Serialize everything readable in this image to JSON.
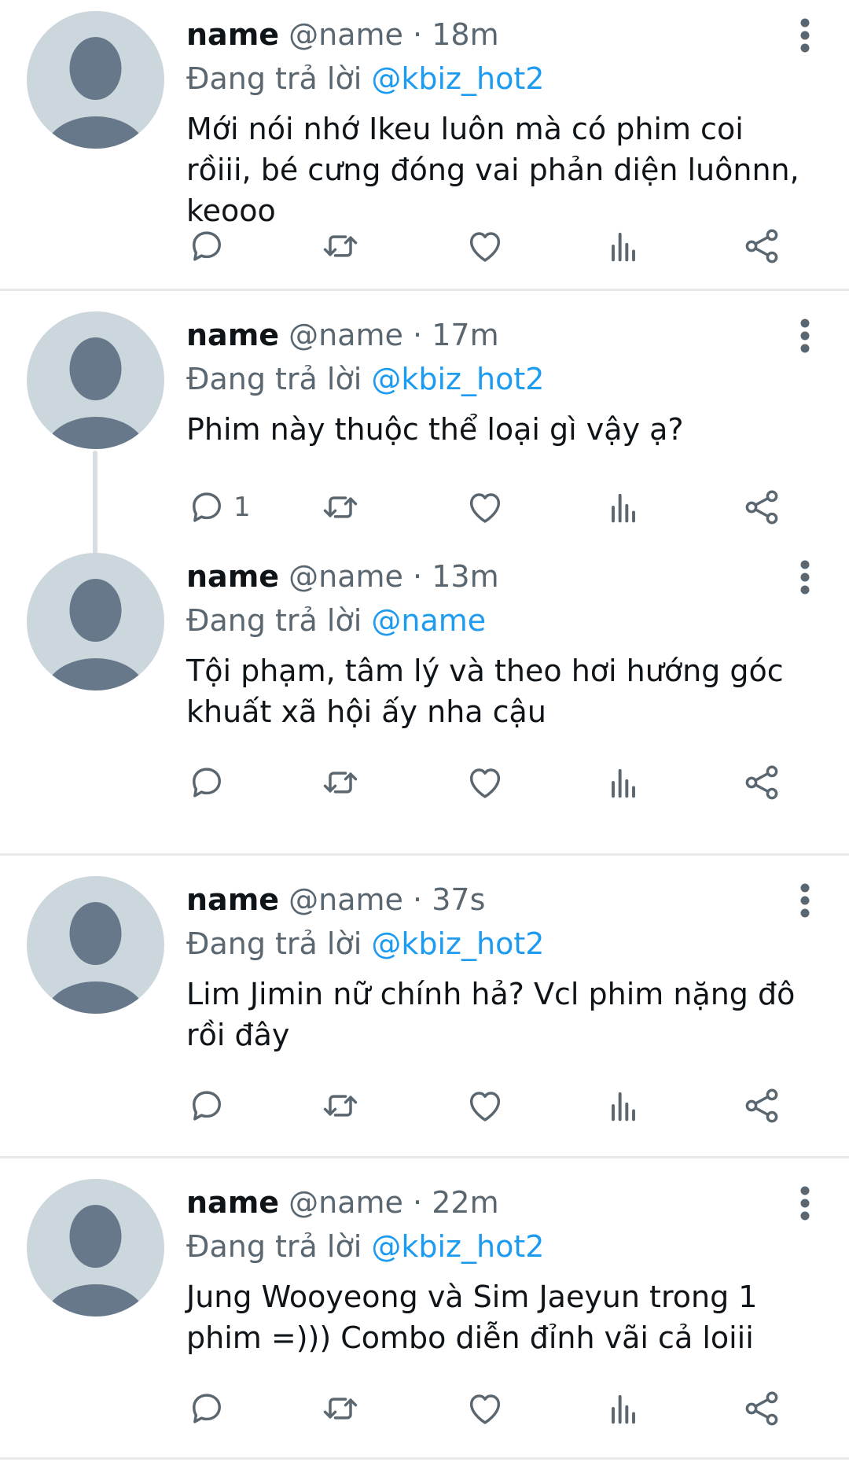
{
  "colors": {
    "text": "#0f1419",
    "secondary": "#5b6770",
    "link": "#1d9bf0",
    "avatar_bg": "#ccd6dd",
    "avatar_fg": "#66788a",
    "separator": "#e7e9eb",
    "thread_line": "#d8dde1"
  },
  "icons": {
    "more": "more-vertical-icon",
    "reply": "speech-bubble-icon",
    "retweet": "retweet-icon",
    "like": "heart-icon",
    "views": "bar-chart-icon",
    "share": "share-icon"
  },
  "reply_prefix": "Đang trả lời",
  "tweets": [
    {
      "display_name": "name",
      "handle": "@name",
      "separator": "·",
      "time": "18m",
      "reply_to": "@kbiz_hot2",
      "text": "Mới nói nhớ Ikeu luôn mà có phim coi rồiii, bé cưng đóng vai phản diện luônnn, keooo",
      "reply_count": ""
    },
    {
      "display_name": "name",
      "handle": "@name",
      "separator": "·",
      "time": "17m",
      "reply_to": "@kbiz_hot2",
      "text": "Phim này thuộc thể loại gì vậy ạ?",
      "reply_count": "1"
    },
    {
      "display_name": "name",
      "handle": "@name",
      "separator": "·",
      "time": "13m",
      "reply_to": "@name",
      "text": "Tội phạm, tâm lý và theo hơi hướng góc khuất xã hội ấy nha cậu",
      "reply_count": ""
    },
    {
      "display_name": "name",
      "handle": "@name",
      "separator": "·",
      "time": "37s",
      "reply_to": "@kbiz_hot2",
      "text": "Lim Jimin nữ chính hả? Vcl phim nặng đô rồi đây",
      "reply_count": ""
    },
    {
      "display_name": "name",
      "handle": "@name",
      "separator": "·",
      "time": "22m",
      "reply_to": "@kbiz_hot2",
      "text": "Jung Wooyeong và Sim Jaeyun trong 1 phim =))) Combo diễn đỉnh vãi cả loiii",
      "reply_count": ""
    }
  ]
}
